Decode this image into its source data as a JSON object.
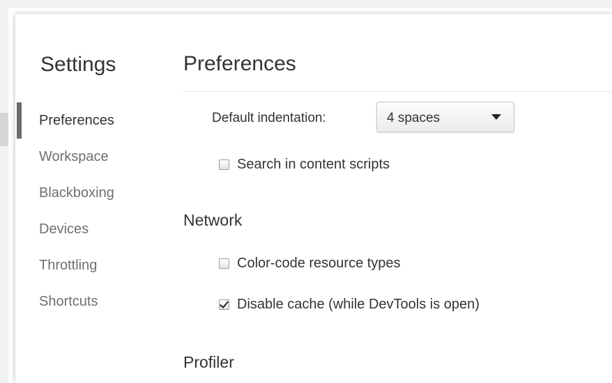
{
  "sidebar": {
    "title": "Settings",
    "items": [
      {
        "label": "Preferences",
        "active": true
      },
      {
        "label": "Workspace",
        "active": false
      },
      {
        "label": "Blackboxing",
        "active": false
      },
      {
        "label": "Devices",
        "active": false
      },
      {
        "label": "Throttling",
        "active": false
      },
      {
        "label": "Shortcuts",
        "active": false
      }
    ]
  },
  "main": {
    "title": "Preferences",
    "default_indentation": {
      "label": "Default indentation:",
      "value": "4 spaces"
    },
    "search_content_scripts": {
      "label": "Search in content scripts",
      "checked": false
    },
    "network": {
      "header": "Network",
      "color_code": {
        "label": "Color-code resource types",
        "checked": false
      },
      "disable_cache": {
        "label": "Disable cache (while DevTools is open)",
        "checked": true
      }
    },
    "profiler": {
      "header": "Profiler"
    }
  }
}
